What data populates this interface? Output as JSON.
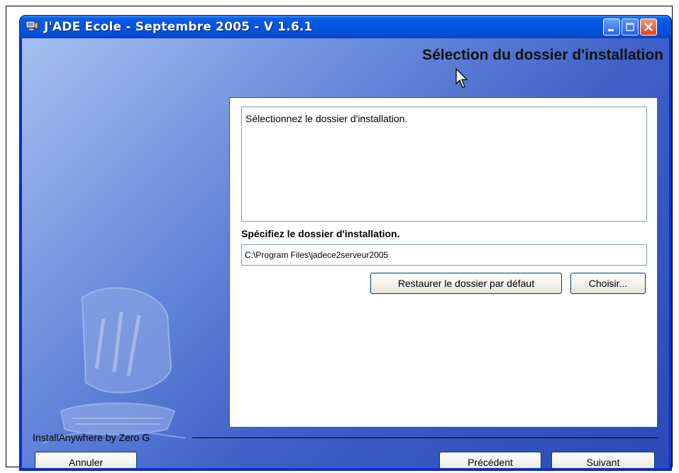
{
  "window": {
    "title": "J'ADE Ecole - Septembre 2005 - V 1.6.1",
    "icon": "installer-app-icon"
  },
  "header": {
    "title": "Sélection du dossier d'installation"
  },
  "panel": {
    "description": "Sélectionnez le dossier d'installation.",
    "field_label": "Spécifiez le dossier d'installation.",
    "path_value": "C:\\Program Files\\jadece2serveur2005",
    "restore_button": "Restaurer le dossier par défaut",
    "choose_button": "Choisir..."
  },
  "footer": {
    "brand": "InstallAnywhere by Zero G",
    "cancel_button": "Annuler",
    "previous_button": "Précédent",
    "next_button": "Suivant"
  },
  "colors": {
    "titlebar": "#0554e3",
    "client_light": "#a7c0f0",
    "client_dark": "#2a4ab8",
    "close_button": "#d74321"
  }
}
